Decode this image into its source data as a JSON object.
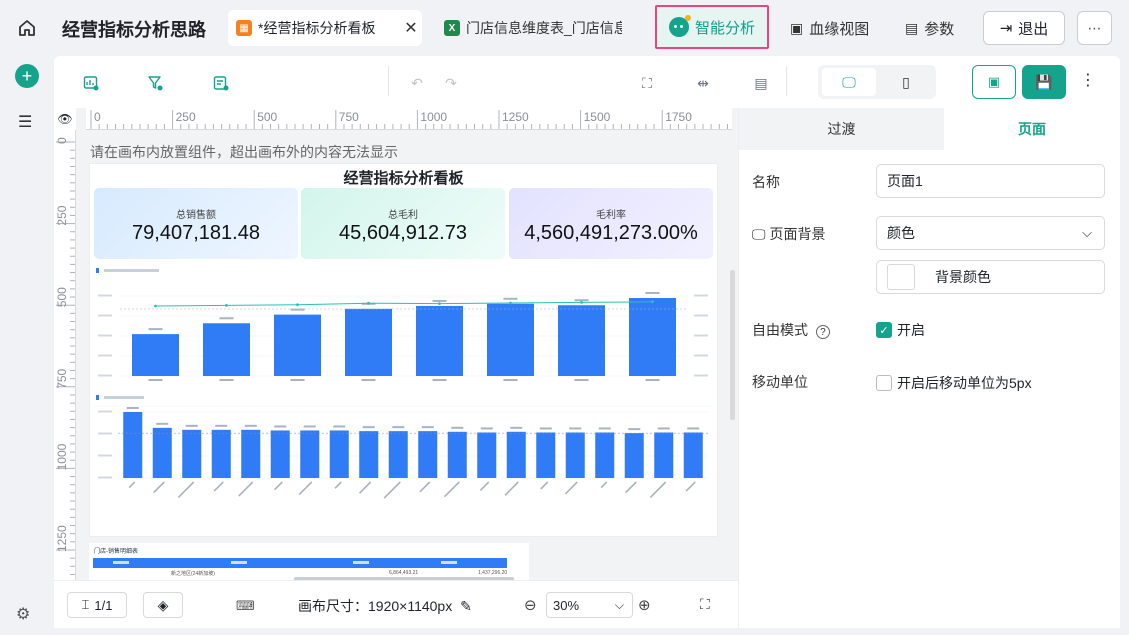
{
  "header": {
    "app_title": "经营指标分析思路",
    "tabs": [
      {
        "label": "*经营指标分析看板",
        "icon": "dashboard-icon",
        "active": true
      },
      {
        "label": "门店信息维度表_门店信息",
        "icon": "excel-icon",
        "active": false
      }
    ],
    "smart_analysis": "智能分析",
    "lineage_view": "血缘视图",
    "params": "参数",
    "exit": "退出"
  },
  "canvas": {
    "hint": "请在画布内放置组件，超出画布外的内容无法显示",
    "ruler_h": [
      "0",
      "250",
      "500",
      "750",
      "1000",
      "1250",
      "1500",
      "1750"
    ],
    "ruler_v": [
      "0",
      "250",
      "500",
      "750",
      "1000",
      "1250"
    ]
  },
  "dashboard": {
    "title": "经营指标分析看板",
    "kpis": [
      {
        "label": "总销售额",
        "value": "79,407,181.48"
      },
      {
        "label": "总毛利",
        "value": "45,604,912.73"
      },
      {
        "label": "毛利率",
        "value": "4,560,491,273.00%"
      }
    ],
    "table_title": "门店-销售明细表",
    "table_row": [
      "",
      "新之地区(24新加坡)",
      "6,864,493.21",
      "1,437,296.20"
    ]
  },
  "bottom": {
    "page_indicator": "1/1",
    "canvas_size_label": "画布尺寸：1920×1140px",
    "zoom": "30%"
  },
  "panel": {
    "tab_transition": "过渡",
    "tab_page": "页面",
    "name_label": "名称",
    "name_value": "页面1",
    "bg_label": "页面背景",
    "bg_value": "颜色",
    "bg_color_label": "背景颜色",
    "free_mode_label": "自由模式",
    "free_mode_value": "开启",
    "move_unit_label": "移动单位",
    "move_unit_value": "开启后移动单位为5px"
  },
  "colors": {
    "accent": "#14a38b",
    "bar": "#2f7cf6",
    "highlight": "#e8467c"
  },
  "chart_data": [
    {
      "type": "bar",
      "values": [
        0.58,
        0.73,
        0.85,
        0.93,
        0.97,
        1.0,
        0.98,
        1.08
      ]
    },
    {
      "type": "bar",
      "values": [
        1.0,
        0.76,
        0.73,
        0.73,
        0.73,
        0.72,
        0.72,
        0.72,
        0.71,
        0.71,
        0.71,
        0.7,
        0.69,
        0.7,
        0.69,
        0.69,
        0.69,
        0.68,
        0.69,
        0.69
      ]
    }
  ]
}
